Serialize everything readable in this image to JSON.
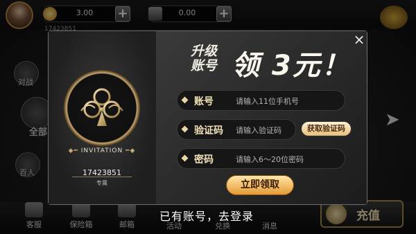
{
  "header": {
    "gold_amount": "3.00",
    "bank_amount": "0.00",
    "user_id_partial": "17423851"
  },
  "side_menu": [
    {
      "label": "对战"
    },
    {
      "label": "全部"
    },
    {
      "label": "百人"
    }
  ],
  "bottom_nav": [
    {
      "label": "客服"
    },
    {
      "label": "保险箱"
    },
    {
      "label": "邮箱"
    },
    {
      "label": "活动"
    },
    {
      "label": "兑换"
    },
    {
      "label": "消息"
    }
  ],
  "recharge_label": "充值",
  "modal": {
    "title_small": "升级\n账号",
    "title_large": "领 3元！",
    "invitation_label": "INVITATION",
    "invitation_code": "17423851",
    "invitation_sub": "专属",
    "fields": [
      {
        "label": "账号",
        "placeholder": "请输入11位手机号"
      },
      {
        "label": "验证码",
        "placeholder": "请输入验证码"
      },
      {
        "label": "密码",
        "placeholder": "请输入6～20位密码"
      }
    ],
    "get_code_label": "获取验证码",
    "claim_label": "立即领取",
    "close_glyph": "×",
    "have_account_text": "已有账号，去登录"
  },
  "colors": {
    "accent_gold": "#e8c98a",
    "modal_border": "#6d6d6d",
    "claim_gradient_top": "#ffe6a8",
    "claim_gradient_bottom": "#e59a35"
  }
}
